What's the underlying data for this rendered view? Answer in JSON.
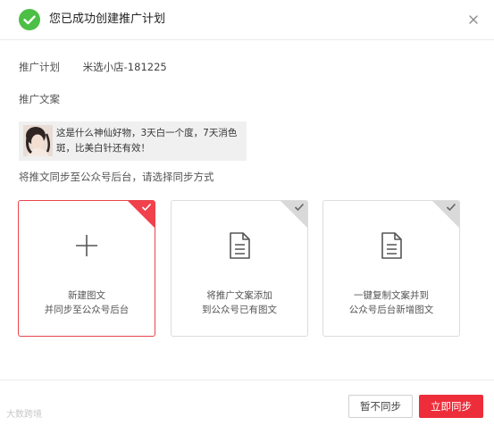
{
  "dialog": {
    "title": "您已成功创建推广计划",
    "close_icon": "close-icon",
    "success_icon": "check-circle-icon",
    "success_color": "#4cbf45"
  },
  "plan": {
    "label": "推广计划",
    "value": "米选小店-181225"
  },
  "copy": {
    "label": "推广文案",
    "text": "这是什么神仙好物，3天白一个度，7天消色斑，比美白针还有效！"
  },
  "sync": {
    "hint": "将推文同步至公众号后台，请选择同步方式",
    "options": [
      {
        "icon": "plus-icon",
        "line1": "新建图文",
        "line2": "并同步至公众号后台",
        "selected": true
      },
      {
        "icon": "document-icon",
        "line1": "将推广文案添加",
        "line2": "到公众号已有图文",
        "selected": false
      },
      {
        "icon": "document-icon",
        "line1": "一键复制文案并到",
        "line2": "公众号后台新增图文",
        "selected": false
      }
    ]
  },
  "footer": {
    "watermark": "大数跨境",
    "skip_label": "暂不同步",
    "sync_now_label": "立即同步",
    "accent_color": "#ed2d3a"
  }
}
